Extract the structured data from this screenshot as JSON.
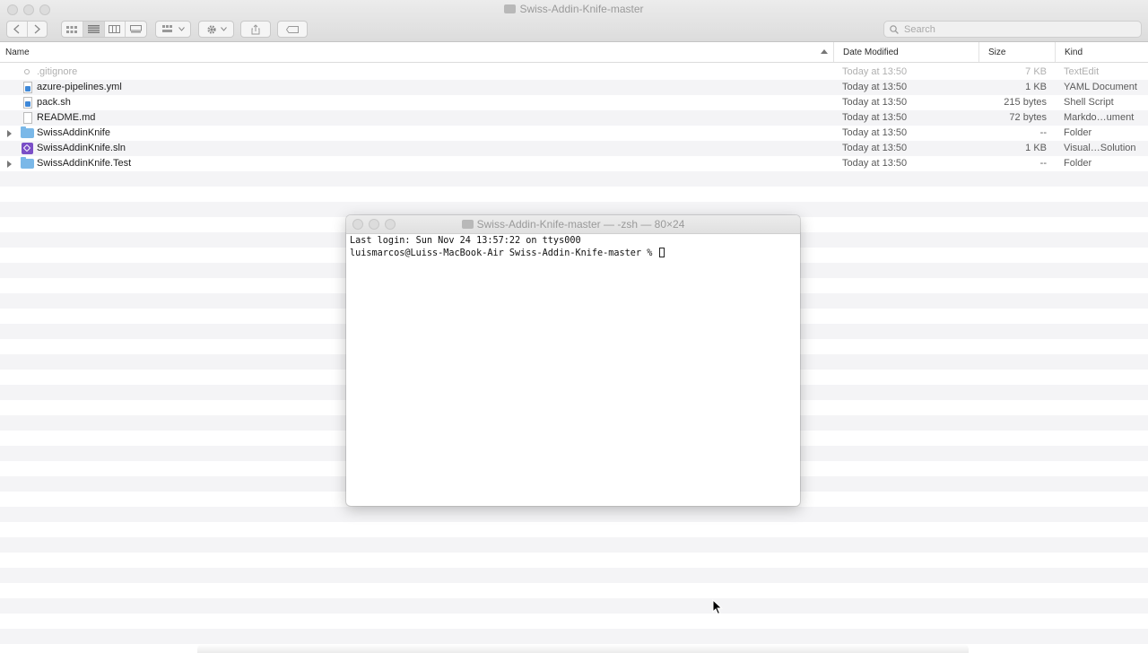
{
  "finder": {
    "title": "Swiss-Addin-Knife-master",
    "search_placeholder": "Search",
    "columns": {
      "name": "Name",
      "date": "Date Modified",
      "size": "Size",
      "kind": "Kind"
    },
    "files": [
      {
        "name": ".gitignore",
        "date": "Today at 13:50",
        "size": "7 KB",
        "kind": "TextEdit",
        "icon": "gitignore-icon"
      },
      {
        "name": "azure-pipelines.yml",
        "date": "Today at 13:50",
        "size": "1 KB",
        "kind": "YAML Document",
        "icon": "yaml-icon"
      },
      {
        "name": "pack.sh",
        "date": "Today at 13:50",
        "size": "215 bytes",
        "kind": "Shell Script",
        "icon": "script-icon"
      },
      {
        "name": "README.md",
        "date": "Today at 13:50",
        "size": "72 bytes",
        "kind": "Markdo…ument",
        "icon": "document-icon"
      },
      {
        "name": "SwissAddinKnife",
        "date": "Today at 13:50",
        "size": "--",
        "kind": "Folder",
        "icon": "folder-icon"
      },
      {
        "name": "SwissAddinKnife.sln",
        "date": "Today at 13:50",
        "size": "1 KB",
        "kind": "Visual…Solution",
        "icon": "visual-studio-icon"
      },
      {
        "name": "SwissAddinKnife.Test",
        "date": "Today at 13:50",
        "size": "--",
        "kind": "Folder",
        "icon": "folder-icon"
      }
    ]
  },
  "terminal": {
    "title": "Swiss-Addin-Knife-master — -zsh — 80×24",
    "line1": "Last login: Sun Nov 24 13:57:22 on ttys000",
    "prompt": "luismarcos@Luiss-MacBook-Air Swiss-Addin-Knife-master % "
  }
}
